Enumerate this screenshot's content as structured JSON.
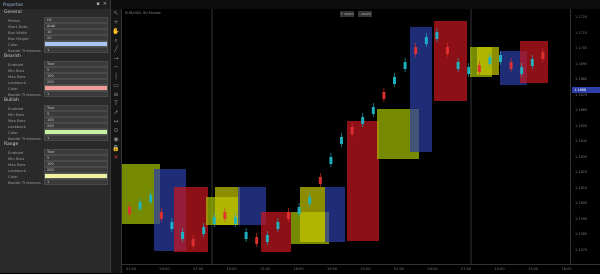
{
  "colors": {
    "accent": "#6fa8dc",
    "panel_bg": "#2a2a2a",
    "blue_block": "#2c3fa8",
    "red_block": "#c8171f",
    "green_block": "#a6c400",
    "olive_block": "#c8c800",
    "candle_up": "#1fb5c5",
    "candle_down": "#e03030"
  },
  "panel": {
    "title": "Properties",
    "sections": [
      {
        "title": "General",
        "rows": [
          {
            "label": "Period",
            "value": "H1"
          },
          {
            "label": "Start Date",
            "value": "Auto"
          },
          {
            "label": "Box Width",
            "value": "10"
          },
          {
            "label": "Box Height",
            "value": "20"
          },
          {
            "label": "Color",
            "value": "",
            "swatch": "#a9c4f5"
          },
          {
            "label": "Border Thickness",
            "value": "1"
          }
        ]
      },
      {
        "title": "Bearish",
        "rows": [
          {
            "label": "Enabled",
            "value": "True"
          },
          {
            "label": "Min Bars",
            "value": "5"
          },
          {
            "label": "Max Bars",
            "value": "100"
          },
          {
            "label": "Lookback",
            "value": "200"
          },
          {
            "label": "Color",
            "value": "",
            "swatch": "#f09a9a"
          },
          {
            "label": "Border Thickness",
            "value": "1"
          }
        ]
      },
      {
        "title": "Bullish",
        "rows": [
          {
            "label": "Enabled",
            "value": "True"
          },
          {
            "label": "Min Bars",
            "value": "5"
          },
          {
            "label": "Max Bars",
            "value": "100"
          },
          {
            "label": "Lookback",
            "value": "200"
          },
          {
            "label": "Color",
            "value": "",
            "swatch": "#c7f0a0"
          },
          {
            "label": "Border Thickness",
            "value": "1"
          }
        ]
      },
      {
        "title": "Range",
        "rows": [
          {
            "label": "Enabled",
            "value": "True"
          },
          {
            "label": "Min Bars",
            "value": "5"
          },
          {
            "label": "Max Bars",
            "value": "100"
          },
          {
            "label": "Lookback",
            "value": "200"
          },
          {
            "label": "Color",
            "value": "",
            "swatch": "#f2f2a0"
          },
          {
            "label": "Border Thickness",
            "value": "1"
          }
        ]
      }
    ]
  },
  "toolbar_icons": [
    "cursor-icon",
    "crosshair-icon",
    "hand-icon",
    "zoom-icon",
    "line-icon",
    "ray-icon",
    "hline-icon",
    "vline-icon",
    "rect-icon",
    "fib-icon",
    "text-icon",
    "arrow-icon",
    "measure-icon",
    "magnet-icon",
    "eye-icon",
    "lock-icon",
    "trash-icon"
  ],
  "chart_header": {
    "label": "EUR/USD, 60 Minute"
  },
  "zoom_buttons": [
    "+ zoom",
    "- zoom"
  ],
  "x_ticks": [
    "01:00",
    "04:00",
    "07:00",
    "10:00",
    "13:00",
    "16:00",
    "19:00",
    "22:00",
    "01:00",
    "04:00",
    "07:00",
    "10:00",
    "13:00",
    "16:00"
  ],
  "y_ticks": [
    "1.1720",
    "1.1710",
    "1.1700",
    "1.1690",
    "1.1680",
    "1.1670",
    "1.1660",
    "1.1650",
    "1.1640",
    "1.1630",
    "1.1620",
    "1.1610",
    "1.1600",
    "1.1590",
    "1.1580",
    "1.1570"
  ],
  "price_tag": "1.1688"
}
